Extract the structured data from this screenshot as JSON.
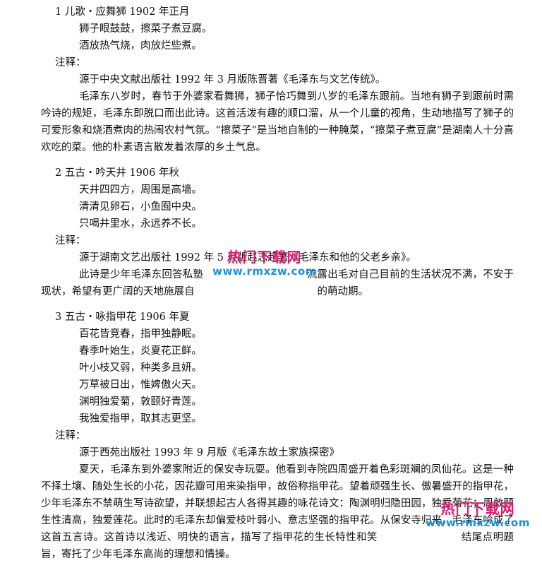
{
  "poems": [
    {
      "heading": "1 儿歌・应舞狮 1902 年正月",
      "lines": [
        "狮子眼鼓鼓，擦菜子煮豆腐。",
        "酒放热气烧，肉放烂些煮。"
      ],
      "note_label": "注释：",
      "source": "源于中央文献出版社 1992 年 3 月版陈晋著《毛泽东与文艺传统》。",
      "paragraph": "毛泽东八岁时，春节于外婆家看舞狮，狮子恰巧舞到八岁的毛泽东跟前。当地有狮子到跟前时需吟诗的规矩，毛泽东即脱口而出此诗。这首活泼有趣的顺口溜，从一个儿童的视角，生动地描写了狮子的可爱形象和烧酒煮肉的热闹农村气氛。“擦菜子”是当地自制的一种腌菜，“擦菜子煮豆腐”是湖南人十分喜欢吃的菜。他的朴素语言散发着浓厚的乡土气息。"
    },
    {
      "heading": "2 五古・吟天井 1906 年秋",
      "lines": [
        "天井四四方，周围是高墙。",
        "清清见卵石，小鱼囿中央。",
        "只喝井里水，永远养不长。"
      ],
      "note_label": "注释：",
      "source": "源于湖南文艺出版社 1992 年 5 月版赵志超著《毛泽东和他的父老乡亲》。",
      "paragraph": "此诗是少年毛泽东回答私塾　　　　　　　　　　流露出毛对自己目前的生活状况不满，不安于现状，希望有更广阔的天地施展自　　　　　　　　　　　　的萌动期。"
    },
    {
      "heading": "3 五古・咏指甲花 1906 年夏",
      "lines": [
        "百花皆竞春，指甲独静眠。",
        "春季叶始生，炎夏花正鲜。",
        "叶小枝又弱，种类多且妍。",
        "万草被日出，惟婢傲火天。",
        "渊明独爱菊，敦颐好青莲。",
        "我独爱指甲，取其志更坚。"
      ],
      "note_label": "注释：",
      "source": "源于西苑出版社 1993 年 9 月版《毛泽东故土家族探密》",
      "paragraph": "夏天，毛泽东到外婆家附近的保安寺玩耍。他看到寺院四周盛开着色彩斑斓的凤仙花。这是一种不择土壤、随处生长的小花，因花瓣可用来染指甲，故俗称指甲花。望着顽强生长、傲暑盛开的指甲花，少年毛泽东不禁萌生写诗欲望，并联想起古人各得其趣的咏花诗文：陶渊明归隐田园，独爱菊花；周敦颐生性清高，独爱莲花。此时的毛泽东却偏爱枝叶弱小、意志坚强的指甲花。从保安寺归来，毛泽东吟成了这首五言诗。这首诗以浅近、明快的语言，描写了指甲花的生长特性和笑　　　　　　　　结尾点明题旨，寄托了少年毛泽东高尚的理想和情操。"
    }
  ],
  "watermarks": [
    {
      "title": "热门下载网",
      "url": "www.rmxzw.com"
    },
    {
      "title": "热门下载网",
      "url": "www.rmxzw.com"
    }
  ]
}
